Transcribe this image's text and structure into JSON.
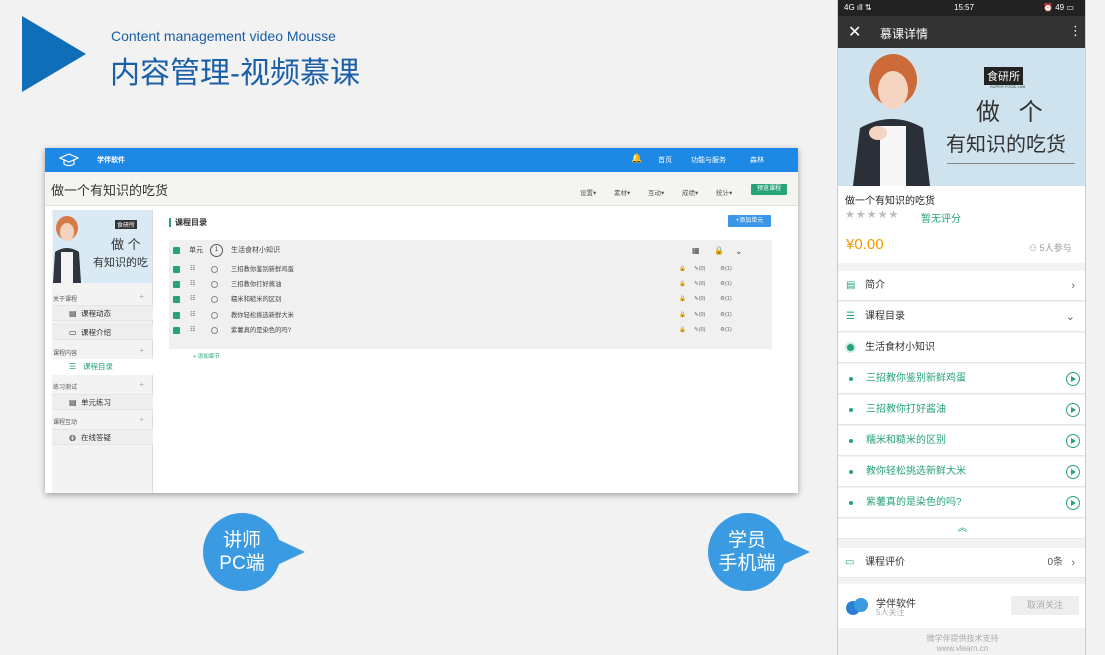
{
  "header": {
    "subtitle_en": "Content management video Mousse",
    "title_cn": "内容管理-视频慕课"
  },
  "pc": {
    "brand": "学伴软件",
    "nav": [
      "首页",
      "功能与服务",
      "森林"
    ],
    "course_title": "做一个有知识的吃货",
    "menus": [
      "设置",
      "素材",
      "互动",
      "成绩",
      "统计"
    ],
    "preview_btn": "预览课程",
    "cover": {
      "badge": "食研所",
      "line1": "做 个",
      "line2": "有知识的吃"
    },
    "sidebar": {
      "sections": [
        {
          "title": "关于课程",
          "items": [
            "课程动态",
            "课程介绍"
          ]
        },
        {
          "title": "课程内容",
          "items": [
            "课程目录"
          ]
        },
        {
          "title": "练习测试",
          "items": [
            "单元练习"
          ]
        },
        {
          "title": "课程互动",
          "items": [
            "在线答疑"
          ]
        }
      ]
    },
    "catalog": {
      "heading": "课程目录",
      "add_unit": "添加单元",
      "unit_label": "单元",
      "unit_num": "1",
      "unit_title": "生活食材小知识",
      "lessons": [
        "三招教你鉴别新鲜鸡蛋",
        "三招教你打好酱油",
        "糯米和糙米的区别",
        "教你轻松挑选新鲜大米",
        "紫薯真的是染色的吗?"
      ],
      "stat_a": "(0)",
      "stat_b": "(1)",
      "add_section": "添加章节"
    }
  },
  "bubbles": {
    "teacher": [
      "讲师",
      "PC端"
    ],
    "student": [
      "学员",
      "手机端"
    ]
  },
  "phone": {
    "status": {
      "network": "4G",
      "time": "15:57",
      "battery": "49"
    },
    "bar_title": "慕课详情",
    "cover": {
      "badge": "食研所",
      "badge_sub": "SUPER FOOD LAB",
      "line1": "做 个",
      "line2": "有知识的吃货"
    },
    "course_title": "做一个有知识的吃货",
    "no_rating": "暂无评分",
    "price": "¥0.00",
    "participants": "5人参与",
    "intro": "简介",
    "catalog": "课程目录",
    "unit": "生活食材小知识",
    "lessons": [
      "三招教你鉴别新鲜鸡蛋",
      "三招教你打好酱油",
      "糯米和糙米的区别",
      "教你轻松挑选新鲜大米",
      "紫薯真的是染色的吗?"
    ],
    "review": "课程评价",
    "review_count": "0条",
    "org_name": "学伴软件",
    "org_followers": "5人关注",
    "unfollow": "取消关注",
    "footer1": "微学伴提供技术支持",
    "footer2": "www.vlearn.cn"
  }
}
